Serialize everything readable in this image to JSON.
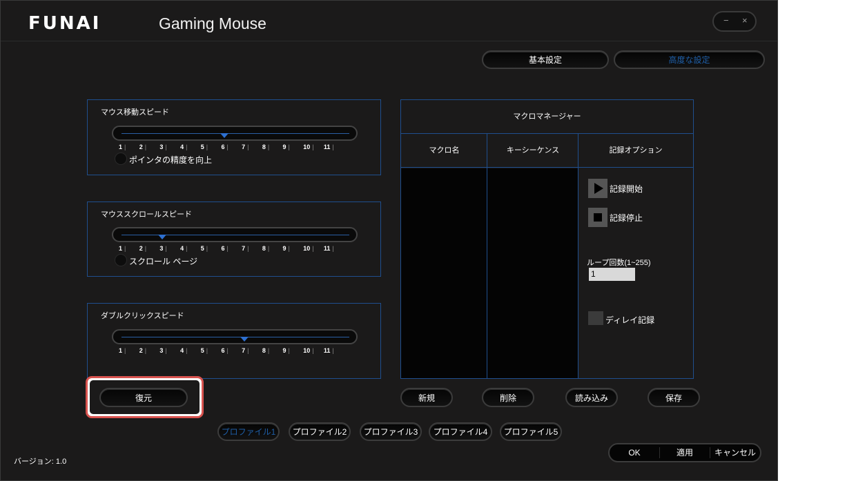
{
  "header": {
    "logo": "FUNAI",
    "product": "Gaming Mouse"
  },
  "window_controls": {
    "minimize": "−",
    "close": "×"
  },
  "mode_tabs": [
    {
      "label": "基本設定",
      "active": false
    },
    {
      "label": "高度な設定",
      "active": true
    }
  ],
  "speed_panel": {
    "title": "マウス移動スピード",
    "value": 6,
    "ticks": [
      "1",
      "2",
      "3",
      "4",
      "5",
      "6",
      "7",
      "8",
      "9",
      "10",
      "11"
    ],
    "option_label": "ポインタの精度を向上"
  },
  "scroll_panel": {
    "title": "マウススクロールスピード",
    "value": 3,
    "ticks": [
      "1",
      "2",
      "3",
      "4",
      "5",
      "6",
      "7",
      "8",
      "9",
      "10",
      "11"
    ],
    "option_label": "スクロール ページ"
  },
  "dblclick_panel": {
    "title": "ダブルクリックスピード",
    "value": 7,
    "ticks": [
      "1",
      "2",
      "3",
      "4",
      "5",
      "6",
      "7",
      "8",
      "9",
      "10",
      "11"
    ]
  },
  "restore_button": "復元",
  "macro_manager": {
    "title": "マクロマネージャー",
    "columns": [
      "マクロ名",
      "キーシーケンス",
      "記録オプション"
    ],
    "record_start": "記録開始",
    "record_stop": "記録停止",
    "loop_label": "ループ回数(1~255)",
    "loop_value": "1",
    "delay_label": "ディレイ記録"
  },
  "macro_buttons": {
    "new": "新規",
    "delete": "削除",
    "load": "読み込み",
    "save": "保存"
  },
  "profiles": [
    {
      "label": "プロファイル1",
      "active": true
    },
    {
      "label": "プロファイル2",
      "active": false
    },
    {
      "label": "プロファイル3",
      "active": false
    },
    {
      "label": "プロファイル4",
      "active": false
    },
    {
      "label": "プロファイル5",
      "active": false
    }
  ],
  "footer": {
    "version": "バージョン: 1.0",
    "ok": "OK",
    "apply": "適用",
    "cancel": "キャンセル"
  },
  "colors": {
    "accent": "#1f5fa8",
    "panel_border": "#1f4f8f",
    "background": "#1b1a1a",
    "highlight": "#d9534f"
  }
}
